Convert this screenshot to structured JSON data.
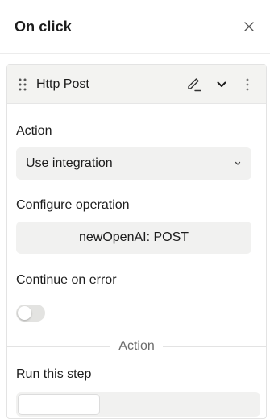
{
  "header": {
    "title": "On click",
    "close_icon": "close-icon"
  },
  "step": {
    "title": "Http Post",
    "icons": [
      "drag-handle-icon",
      "edit-icon",
      "chevron-down-icon",
      "more-vertical-icon"
    ]
  },
  "action_field": {
    "label": "Action",
    "value": "Use integration"
  },
  "configure_field": {
    "label": "Configure operation",
    "value": "newOpenAI: POST"
  },
  "continue_on_error": {
    "label": "Continue on error",
    "enabled": false
  },
  "divider_label": "Action",
  "run_step": {
    "label": "Run this step"
  },
  "colors": {
    "field_bg": "#f1f1f0",
    "header_bg": "#f3f3f1",
    "toggle_off": "#e3e3e1"
  }
}
